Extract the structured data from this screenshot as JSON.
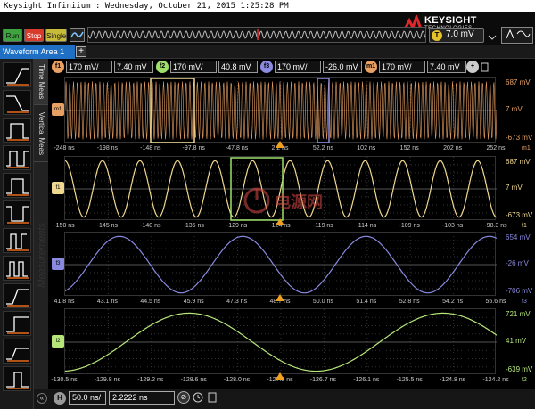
{
  "titlebar": "Keysight Infiniium : Wednesday, October 21, 2015 1:25:28 PM",
  "brand": {
    "name": "KEYSIGHT",
    "sub": "TECHNOLOGIES"
  },
  "controls": {
    "run": "Run",
    "stop": "Stop",
    "single": "Single"
  },
  "trigger_time": "7.0 mV",
  "trigger_badge": "T",
  "tab": {
    "label": "Waveform Area 1",
    "add": "+"
  },
  "side_tabs": [
    "Time Meas",
    "Vertical Meas"
  ],
  "side_watermark": "Measurements",
  "channels": [
    {
      "id": "f1",
      "scale": "170 mV/",
      "offset": "7.40 mV",
      "color": "#e8a063"
    },
    {
      "id": "f2",
      "scale": "170 mV/",
      "offset": "40.8 mV",
      "color": "#9ee06a"
    },
    {
      "id": "f3",
      "scale": "170 mV/",
      "offset": "-26.0 mV",
      "color": "#8a8ae0"
    },
    {
      "id": "m1",
      "scale": "170 mV/",
      "offset": "7.40 mV",
      "color": "#e8a063"
    }
  ],
  "panels": [
    {
      "marker": "m1",
      "color": "#e8a063",
      "right": [
        "687 mV",
        "7 mV",
        "-673 mV"
      ],
      "corner": "m1",
      "x": [
        "-248 ns",
        "-198 ns",
        "-148 ns",
        "-97.8 ns",
        "-47.8 ns",
        "2.2 ns",
        "52.2 ns",
        "102 ns",
        "152 ns",
        "202 ns",
        "252 ns"
      ]
    },
    {
      "marker": "f1",
      "color": "#f0d890",
      "right": [
        "687 mV",
        "7 mV",
        "-673 mV"
      ],
      "corner": "f1",
      "x": [
        "-150 ns",
        "-145 ns",
        "-140 ns",
        "-135 ns",
        "-129 ns",
        "-124 ns",
        "-119 ns",
        "-114 ns",
        "-109 ns",
        "-103 ns",
        "-98.3 ns"
      ]
    },
    {
      "marker": "f3",
      "color": "#8a8ae0",
      "right": [
        "654 mV",
        "-26 mV",
        "-706 mV"
      ],
      "corner": "f3",
      "x": [
        "41.8 ns",
        "43.1 ns",
        "44.5 ns",
        "45.9 ns",
        "47.3 ns",
        "48.7 ns",
        "50.0 ns",
        "51.4 ns",
        "52.8 ns",
        "54.2 ns",
        "55.6 ns"
      ]
    },
    {
      "marker": "f2",
      "color": "#b6e67a",
      "right": [
        "721 mV",
        "41 mV",
        "-639 mV"
      ],
      "corner": "f2",
      "x": [
        "-130.5 ns",
        "-129.8 ns",
        "-129.2 ns",
        "-128.6 ns",
        "-128.0 ns",
        "-127.3 ns",
        "-126.7 ns",
        "-126.1 ns",
        "-125.5 ns",
        "-124.8 ns",
        "-124.2 ns"
      ]
    }
  ],
  "horizontal": {
    "badge": "H",
    "scale": "50.0 ns/",
    "position": "2.2222 ns"
  },
  "watermark": "电源网",
  "autoscale_icon": "autoscale-icon"
}
